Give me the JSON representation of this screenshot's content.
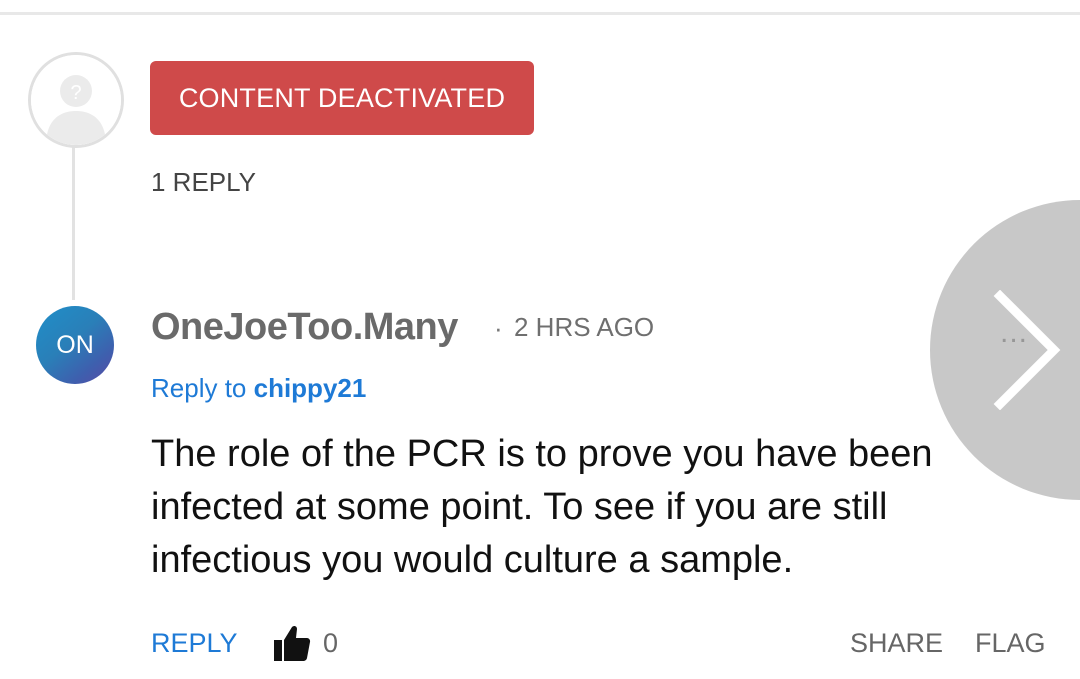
{
  "parent_comment": {
    "avatar_icon": "anonymous-user-icon",
    "status_badge": "CONTENT DEACTIVATED",
    "reply_count": "1 REPLY"
  },
  "reply_comment": {
    "avatar_initials": "ON",
    "author": "OneJoeToo.Many",
    "separator": "·",
    "timestamp": "2 HRS AGO",
    "reply_to_prefix": "Reply to ",
    "reply_to_user": "chippy21",
    "body": "The role of the PCR is to prove you have been infected at some point. To see if you are still infectious you would culture a sample.",
    "more_menu": "...",
    "actions": {
      "reply_label": "REPLY",
      "like_icon": "thumbs-up-icon",
      "like_count": "0",
      "share_label": "SHARE",
      "flag_label": "FLAG"
    }
  },
  "overlay": {
    "icon": "chevron-right-icon"
  },
  "colors": {
    "badge_red": "#cf4a4a",
    "link_blue": "#1e7ad6",
    "avatar_gradient_start": "#1f8fc9",
    "avatar_gradient_end": "#5a4aa5"
  }
}
